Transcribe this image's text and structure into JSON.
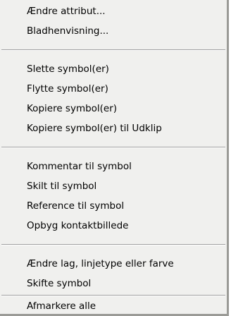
{
  "menu": {
    "groups": [
      {
        "items": [
          {
            "label": "Ændre attribut..."
          },
          {
            "label": "Bladhenvisning..."
          }
        ]
      },
      {
        "items": [
          {
            "label": "Slette symbol(er)"
          },
          {
            "label": "Flytte symbol(er)"
          },
          {
            "label": "Kopiere symbol(er)"
          },
          {
            "label": "Kopiere symbol(er) til Udklip"
          }
        ]
      },
      {
        "items": [
          {
            "label": "Kommentar til symbol"
          },
          {
            "label": "Skilt til symbol"
          },
          {
            "label": "Reference til symbol"
          },
          {
            "label": "Opbyg kontaktbillede"
          }
        ]
      },
      {
        "items": [
          {
            "label": "Ændre lag, linjetype eller farve"
          },
          {
            "label": "Skifte symbol"
          }
        ]
      },
      {
        "items": [
          {
            "label": "Afmarkere alle"
          }
        ]
      }
    ]
  }
}
